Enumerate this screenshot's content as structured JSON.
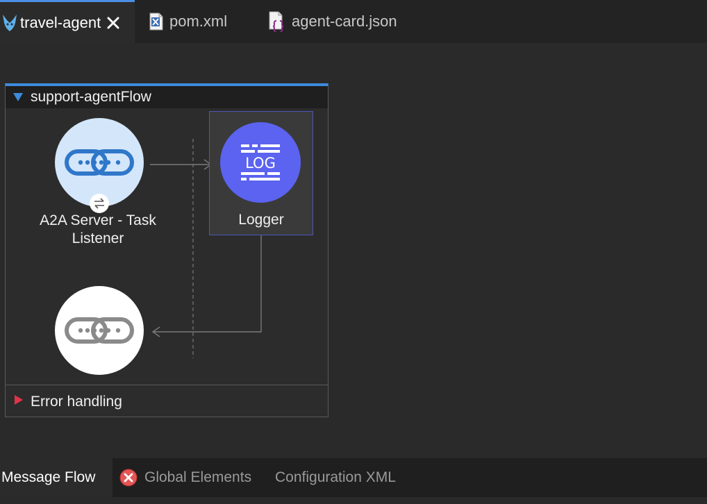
{
  "editor_tabs": [
    {
      "label": "travel-agent",
      "icon": "mule-icon",
      "active": true
    },
    {
      "label": "pom.xml",
      "icon": "xml-file-icon",
      "active": false
    },
    {
      "label": "agent-card.json",
      "icon": "json-file-icon",
      "active": false
    }
  ],
  "flow": {
    "title": "support-agentFlow",
    "nodes": [
      {
        "label": "A2A Server - Task Listener",
        "icon": "chain-link-icon",
        "badge_icon": "exchange-arrows-icon"
      },
      {
        "label": "Logger",
        "icon": "log-icon",
        "icon_text": "LOG"
      },
      {
        "label": "",
        "icon": "chain-link-icon"
      }
    ],
    "error_section": {
      "label": "Error handling"
    }
  },
  "bottom_tabs": [
    {
      "label": "Message Flow",
      "active": true
    },
    {
      "label": "Global Elements",
      "active": false,
      "icon": "error-icon"
    },
    {
      "label": "Configuration XML",
      "active": false
    }
  ],
  "colors": {
    "accent": "#3d8bdc",
    "logger": "#5b63f0",
    "listener_bg": "#d4e6fa",
    "error": "#e0334a"
  }
}
